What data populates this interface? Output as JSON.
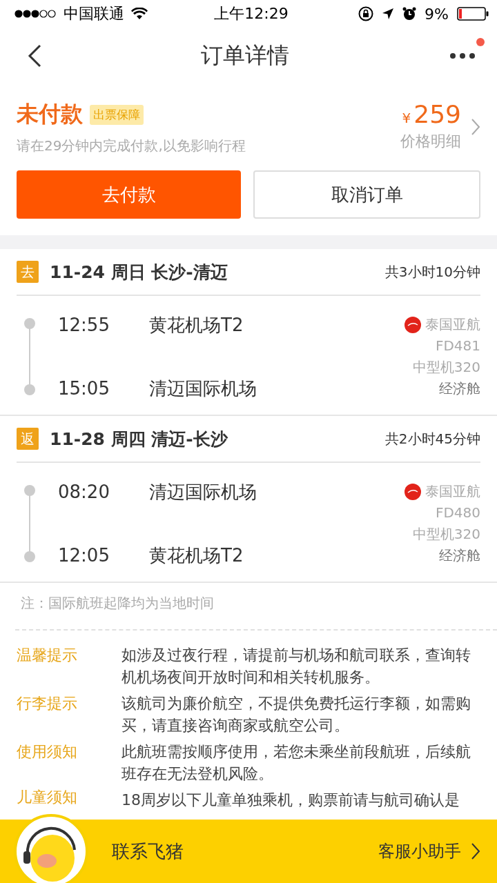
{
  "status_bar": {
    "carrier": "中国联通",
    "time": "上午12:29",
    "battery": "9%"
  },
  "nav": {
    "title": "订单详情",
    "notification": true
  },
  "order": {
    "status": "未付款",
    "tag": "出票保障",
    "hint": "请在29分钟内完成付款,以免影响行程",
    "currency": "¥",
    "price": "259",
    "price_label": "价格明细",
    "buttons": [
      {
        "label": "去付款",
        "kind": "primary"
      },
      {
        "label": "取消订单",
        "kind": "secondary"
      }
    ]
  },
  "flights": [
    {
      "direction": "去",
      "date_route": "11-24 周日 长沙-清迈",
      "duration": "共3小时10分钟",
      "departure": {
        "time": "12:55",
        "airport": "黄花机场T2"
      },
      "arrival": {
        "time": "15:05",
        "airport": "清迈国际机场"
      },
      "airline": "泰国亚航",
      "flight_no": "FD481",
      "aircraft": "中型机320",
      "cabin": "经济舱"
    },
    {
      "direction": "返",
      "date_route": "11-28 周四 清迈-长沙",
      "duration": "共2小时45分钟",
      "departure": {
        "time": "08:20",
        "airport": "清迈国际机场"
      },
      "arrival": {
        "time": "12:05",
        "airport": "黄花机场T2"
      },
      "airline": "泰国亚航",
      "flight_no": "FD480",
      "aircraft": "中型机320",
      "cabin": "经济舱"
    }
  ],
  "note": "注：国际航班起降均为当地时间",
  "tips": [
    {
      "label": "温馨提示",
      "text": "如涉及过夜行程，请提前与机场和航司联系，查询转机机场夜间开放时间和相关转机服务。"
    },
    {
      "label": "行李提示",
      "text": "该航司为廉价航空，不提供免费托运行李额，如需购买，请直接咨询商家或航空公司。"
    },
    {
      "label": "使用须知",
      "text": "此航班需按顺序使用，若您未乘坐前段航班，后续航班存在无法登机风险。"
    },
    {
      "label": "儿童须知",
      "text": "18周岁以下儿童单独乘机，购票前请与航司确认是"
    }
  ],
  "bottom_bar": {
    "contact": "联系飞猪",
    "assistant": "客服小助手"
  }
}
